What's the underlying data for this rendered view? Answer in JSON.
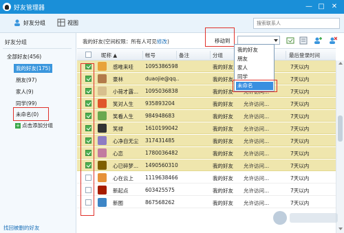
{
  "window": {
    "title": "好友管理器",
    "controls": [
      "—",
      "□",
      "✕"
    ]
  },
  "toolbar": {
    "friend_group_label": "好友分组",
    "view_label": "视图",
    "search_placeholder": "搜索联系人"
  },
  "sidebar": {
    "header": "好友分组",
    "items": [
      {
        "label": "全部好友(456)",
        "selected": false,
        "root": true
      },
      {
        "label": "我的好友(175)",
        "selected": true,
        "root": false
      },
      {
        "label": "朋友(97)",
        "selected": false,
        "root": false
      },
      {
        "label": "家人(9)",
        "selected": false,
        "root": false
      },
      {
        "label": "同学(99)",
        "selected": false,
        "root": false
      },
      {
        "label": "未命名(0)",
        "selected": false,
        "root": false
      }
    ],
    "add_group_label": "点击添加分组",
    "footer_link": "找回被删的好友"
  },
  "main": {
    "friends_label_prefix": "我的好友(空间权限：所有人可见",
    "friends_label_link": "修改",
    "friends_label_suffix": ")",
    "move_to_label": "移动到",
    "columns": {
      "nickname": "昵称",
      "account": "帐号",
      "remark": "备注",
      "group": "分组",
      "last_login": "最后登录时间"
    },
    "sort_indicator": "▲"
  },
  "dropdown": {
    "options": [
      "我的好友",
      "朋友",
      "家人",
      "同学",
      "未命名"
    ],
    "selected_index": 4
  },
  "rows": [
    {
      "name": "感唯来哇",
      "account": "1095386598",
      "group": "我的好友",
      "perm": "",
      "last": "7天以内",
      "checked": true,
      "color": "#e8a33a"
    },
    {
      "name": "豪林",
      "account": "duaojie@qq....",
      "group": "我的好友",
      "perm": "",
      "last": "7天以内",
      "checked": true,
      "color": "#b27a4a"
    },
    {
      "name": "小荷才露...",
      "account": "1095036838",
      "group": "我的好友",
      "perm": "允许访问...",
      "last": "7天以内",
      "checked": true,
      "color": "#d7c08e"
    },
    {
      "name": "笑对人生",
      "account": "935893204",
      "group": "我的好友",
      "perm": "允许访问...",
      "last": "7天以内",
      "checked": true,
      "color": "#e0552b"
    },
    {
      "name": "笑看人生",
      "account": "984948683",
      "group": "我的好友",
      "perm": "允许访问...",
      "last": "7天以内",
      "checked": true,
      "color": "#6aa84f"
    },
    {
      "name": "笑禄",
      "account": "1610199042",
      "group": "我的好友",
      "perm": "允许访问...",
      "last": "7天以内",
      "checked": true,
      "color": "#333333"
    },
    {
      "name": "心净自无尘",
      "account": "317431485",
      "group": "我的好友",
      "perm": "允许访问...",
      "last": "7天以内",
      "checked": true,
      "color": "#8e7cc3"
    },
    {
      "name": "心恋",
      "account": "1780036482",
      "group": "我的好友",
      "perm": "允许访问...",
      "last": "7天以内",
      "checked": true,
      "color": "#c27ba0"
    },
    {
      "name": "心已碎梦...",
      "account": "1490560310",
      "group": "我的好友",
      "perm": "允许访问...",
      "last": "7天以内",
      "checked": true,
      "color": "#7f6000"
    },
    {
      "name": "心在云上",
      "account": "1119638466",
      "group": "我的好友",
      "perm": "允许访问...",
      "last": "7天以内",
      "checked": false,
      "color": "#e69138"
    },
    {
      "name": "新起点",
      "account": "603425575",
      "group": "我的好友",
      "perm": "允许访问...",
      "last": "7天以内",
      "checked": false,
      "color": "#a61c00"
    },
    {
      "name": "新图",
      "account": "867568262",
      "group": "我的好友",
      "perm": "允许访问...",
      "last": "7天以内",
      "checked": false,
      "color": "#3d85c6"
    }
  ],
  "colors": {
    "titlebar": "#1a8fd8",
    "selected_row": "#efe6ad",
    "sidebar_selected": "#3a96dd",
    "annotation_red": "#e0302a"
  }
}
